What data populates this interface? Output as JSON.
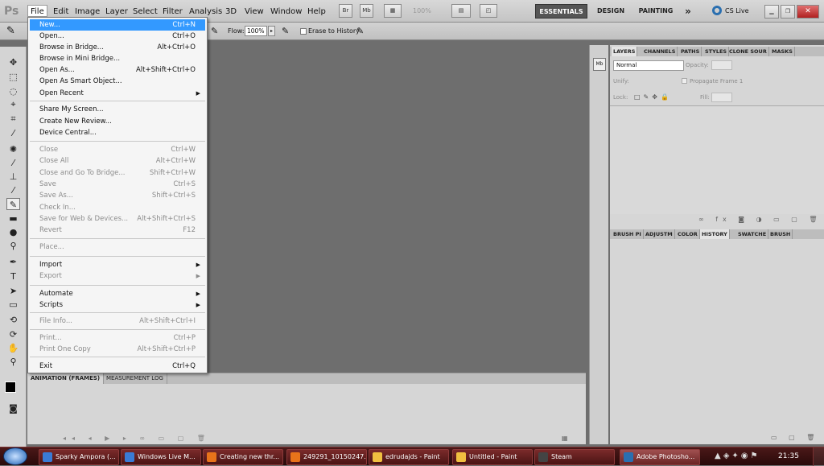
{
  "app": {
    "logo": "Ps"
  },
  "menubar": {
    "items": [
      "File",
      "Edit",
      "Image",
      "Layer",
      "Select",
      "Filter",
      "Analysis",
      "3D",
      "View",
      "Window",
      "Help"
    ],
    "br_label": "Br",
    "mb_label": "Mb",
    "zoom": "100%",
    "workspaces": [
      "ESSENTIALS",
      "DESIGN",
      "PAINTING"
    ],
    "more": "»",
    "cslive": "CS Live"
  },
  "options": {
    "flow_label": "Flow:",
    "flow_value": "100%",
    "erase_history": "Erase to History"
  },
  "file_menu": {
    "items": [
      {
        "label": "New...",
        "shortcut": "Ctrl+N",
        "disabled": false,
        "highlight": true
      },
      {
        "label": "Open...",
        "shortcut": "Ctrl+O"
      },
      {
        "label": "Browse in Bridge...",
        "shortcut": "Alt+Ctrl+O"
      },
      {
        "label": "Browse in Mini Bridge..."
      },
      {
        "label": "Open As...",
        "shortcut": "Alt+Shift+Ctrl+O"
      },
      {
        "label": "Open As Smart Object..."
      },
      {
        "label": "Open Recent",
        "submenu": true
      },
      {
        "label": "Share My Screen..."
      },
      {
        "label": "Create New Review..."
      },
      {
        "label": "Device Central..."
      },
      {
        "label": "Close",
        "shortcut": "Ctrl+W",
        "disabled": true
      },
      {
        "label": "Close All",
        "shortcut": "Alt+Ctrl+W",
        "disabled": true
      },
      {
        "label": "Close and Go To Bridge...",
        "shortcut": "Shift+Ctrl+W",
        "disabled": true
      },
      {
        "label": "Save",
        "shortcut": "Ctrl+S",
        "disabled": true
      },
      {
        "label": "Save As...",
        "shortcut": "Shift+Ctrl+S",
        "disabled": true
      },
      {
        "label": "Check In...",
        "disabled": true
      },
      {
        "label": "Save for Web & Devices...",
        "shortcut": "Alt+Shift+Ctrl+S",
        "disabled": true
      },
      {
        "label": "Revert",
        "shortcut": "F12",
        "disabled": true
      },
      {
        "label": "Place...",
        "disabled": true
      },
      {
        "label": "Import",
        "submenu": true
      },
      {
        "label": "Export",
        "submenu": true,
        "disabled": true
      },
      {
        "label": "Automate",
        "submenu": true
      },
      {
        "label": "Scripts",
        "submenu": true
      },
      {
        "label": "File Info...",
        "shortcut": "Alt+Shift+Ctrl+I",
        "disabled": true
      },
      {
        "label": "Print...",
        "shortcut": "Ctrl+P",
        "disabled": true
      },
      {
        "label": "Print One Copy",
        "shortcut": "Alt+Shift+Ctrl+P",
        "disabled": true
      },
      {
        "label": "Exit",
        "shortcut": "Ctrl+Q"
      }
    ]
  },
  "bottom_panel": {
    "tabs": [
      "ANIMATION (FRAMES)",
      "MEASUREMENT LOG"
    ]
  },
  "layers_panel": {
    "tabs": [
      "LAYERS",
      "CHANNELS",
      "PATHS",
      "STYLES",
      "CLONE SOUR",
      "MASKS"
    ],
    "blend_mode": "Normal",
    "opacity_label": "Opacity:",
    "unify_label": "Unify:",
    "propagate_label": "Propagate Frame 1",
    "lock_label": "Lock:",
    "fill_label": "Fill:"
  },
  "history_panel": {
    "tabs": [
      "BRUSH PI",
      "ADJUSTM",
      "COLOR",
      "HISTORY",
      "SWATCHE",
      "BRUSH"
    ]
  },
  "taskbar": {
    "items": [
      {
        "label": "Sparky Ampora (...",
        "color": "#3a7bd5"
      },
      {
        "label": "Windows Live M...",
        "color": "#3a7bd5"
      },
      {
        "label": "Creating new thr...",
        "color": "#e8731a"
      },
      {
        "label": "249291_10150247...",
        "color": "#e8731a"
      },
      {
        "label": "edrudajds - Paint",
        "color": "#f0c040"
      },
      {
        "label": "Untitled - Paint",
        "color": "#f0c040"
      },
      {
        "label": "Steam",
        "color": "#444444"
      },
      {
        "label": "Adobe Photosho...",
        "color": "#2a6fb0"
      }
    ],
    "clock": "21:35"
  }
}
